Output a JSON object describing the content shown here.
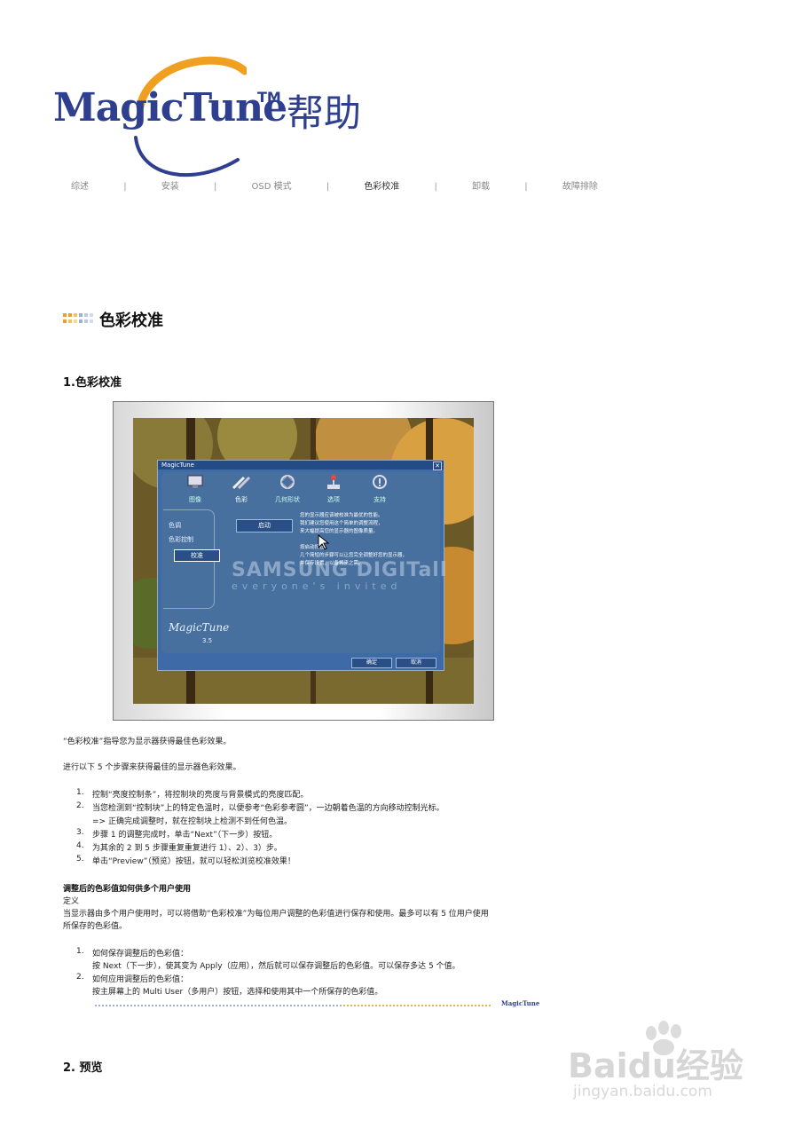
{
  "header": {
    "logo_text": "MagicTune",
    "logo_tm": "TM",
    "help_title": "帮助"
  },
  "nav": {
    "items": [
      "综述",
      "安装",
      "OSD 模式",
      "色彩校准",
      "卸载",
      "故障排除"
    ],
    "separator": "|",
    "active_index": 3
  },
  "section": {
    "title": "色彩校准",
    "subtitle_1": "1.色彩校准",
    "subtitle_2": "2. 预览"
  },
  "app_window": {
    "title": "MagicTune",
    "close": "✕",
    "tabs": [
      "图像",
      "色彩",
      "几何形状",
      "选项",
      "支持"
    ],
    "active_tab": 1,
    "side_items": [
      "色调",
      "色彩控制"
    ],
    "calibrate_button": "校准",
    "start_button": "启动",
    "info_lines": [
      "您的显示器应该被校准为最优的性能。",
      "我们建议您使用这个简单的调整流程，",
      "来大幅提高您的显示器的图像质量。",
      "",
      "按启动按钮，",
      "几个简短的步骤可以让您完全调整好您的显示器，",
      "并保存设置，以备将来之需。"
    ],
    "watermark_brand": "SAMSUNG DIGITall",
    "watermark_slogan": "everyone's invited",
    "mini_logo": "MagicTune",
    "version": "3.5",
    "ok_button": "确定",
    "cancel_button": "取消"
  },
  "body": {
    "intro": "“色彩校准”指导您为显示器获得最佳色彩效果。",
    "steps_intro": "进行以下 5 个步骤来获得最佳的显示器色彩效果。",
    "steps": [
      {
        "num": "1.",
        "text": "控制“亮度控制条”，将控制块的亮度与背景模式的亮度匹配。"
      },
      {
        "num": "2.",
        "text": "当您检测到“控制块”上的特定色温时，以便参考“色彩参考圆”，一边朝着色温的方向移动控制光标。"
      },
      {
        "num": "",
        "text": "=> 正确完成调整时，就在控制块上检测不到任何色温。"
      },
      {
        "num": "3.",
        "text": "步骤 1 的调整完成时，单击“Next”（下一步）按钮。"
      },
      {
        "num": "4.",
        "text": "为其余的 2 到 5 步骤重复重复进行 1）、2）、3）步。"
      },
      {
        "num": "5.",
        "text": "单击“Preview”（预览）按钮，就可以轻松浏览校准效果！"
      }
    ],
    "multi_user_heading": "调整后的色彩值如何供多个用户使用",
    "definition_label": "定义",
    "definition_line1": "当显示器由多个用户使用时，可以将借助“色彩校准”为每位用户调整的色彩值进行保存和使用。最多可以有 5 位用户使用",
    "definition_line2": "所保存的色彩值。",
    "howto": [
      {
        "num": "1.",
        "title": "如何保存调整后的色彩值：",
        "text": "按 Next（下一步），使其变为 Apply（应用），然后就可以保存调整后的色彩值。可以保存多达 5 个值。"
      },
      {
        "num": "2.",
        "title": "如何应用调整后的色彩值：",
        "text": "按主屏幕上的 Multi User（多用户）按钮，选择和使用其中一个所保存的色彩值。"
      }
    ],
    "footer_logo": "MagicTune"
  },
  "watermark": {
    "brand": "Baidu经验",
    "url": "jingyan.baidu.com"
  },
  "colors": {
    "brand_blue": "#2e3f8f",
    "brand_orange": "#f0a020",
    "window_blue": "#3e6aa8"
  }
}
